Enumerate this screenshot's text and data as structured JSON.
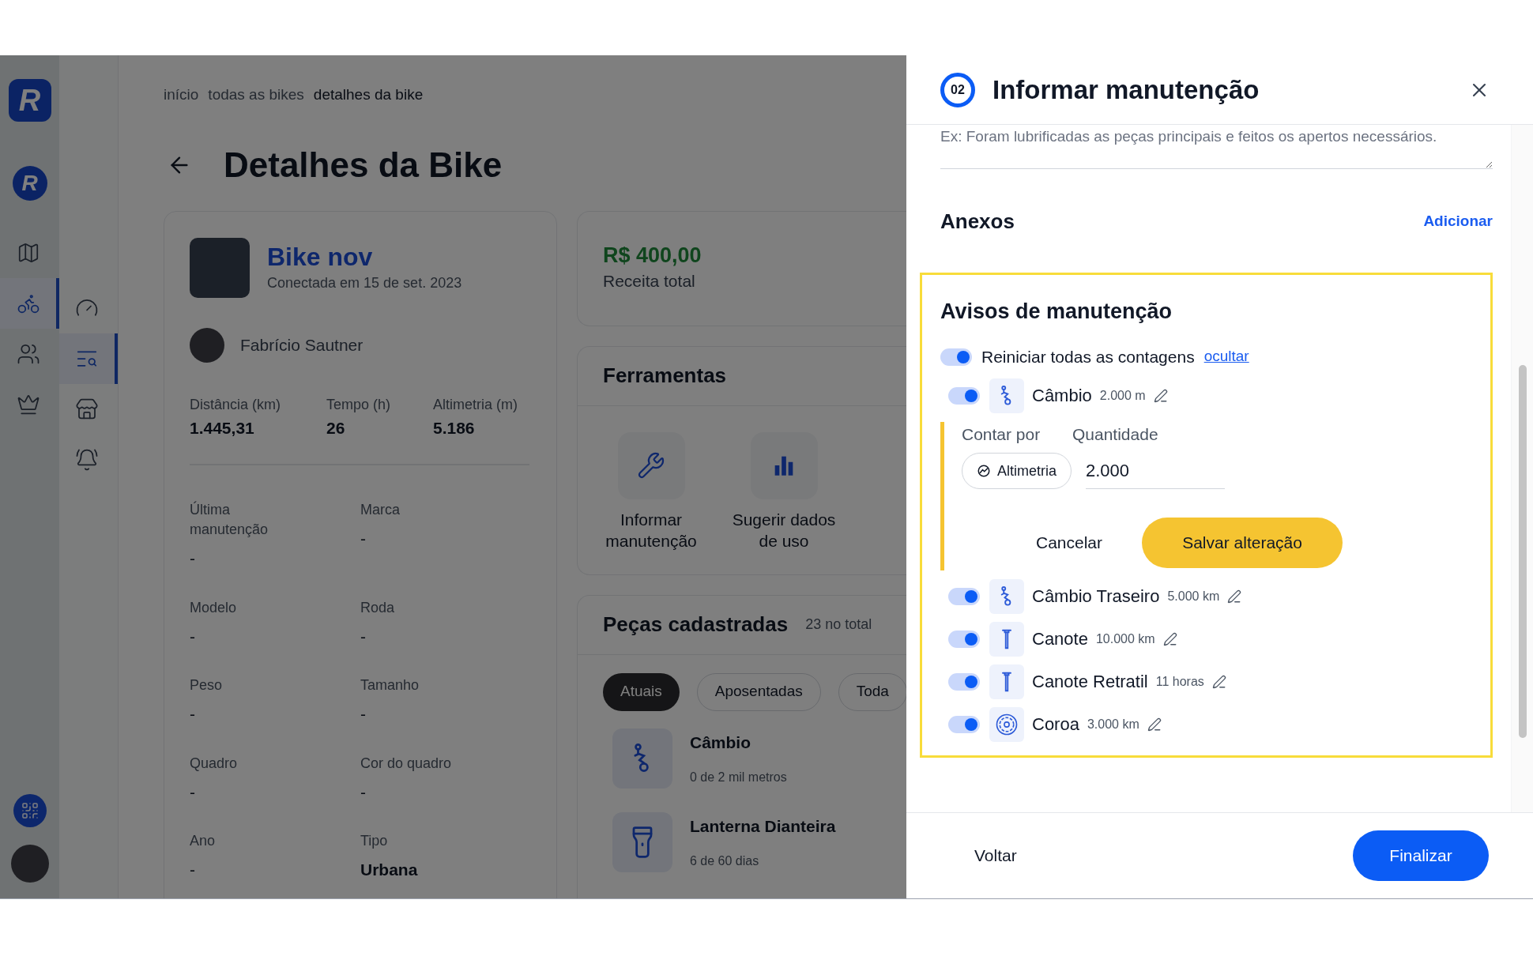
{
  "sidebar": {
    "logo": "R",
    "brand": "R",
    "primary": [
      {
        "kind": "map",
        "selected": false
      },
      {
        "kind": "bike",
        "selected": true
      },
      {
        "kind": "users",
        "selected": false
      },
      {
        "kind": "crown",
        "selected": false
      }
    ],
    "secondary": [
      {
        "kind": "gauge",
        "selected": false
      },
      {
        "kind": "search-list",
        "selected": true
      },
      {
        "kind": "store",
        "selected": false
      },
      {
        "kind": "bell",
        "selected": false
      }
    ]
  },
  "breadcrumb": [
    {
      "label": "início",
      "current": false
    },
    {
      "label": "todas as bikes",
      "current": false
    },
    {
      "label": "detalhes da bike",
      "current": true
    }
  ],
  "page_title": "Detalhes da Bike",
  "bike": {
    "name": "Bike nov",
    "connected": "Conectada em 15 de set. 2023",
    "owner": "Fabrício Sautner",
    "stats": [
      {
        "label": "Distância (km)",
        "value": "1.445,31"
      },
      {
        "label": "Tempo (h)",
        "value": "26"
      },
      {
        "label": "Altimetria (m)",
        "value": "5.186"
      }
    ],
    "specs": [
      {
        "label": "Última manutenção",
        "value": "-"
      },
      {
        "label": "Marca",
        "value": "-"
      },
      {
        "label": "Modelo",
        "value": "-"
      },
      {
        "label": "Roda",
        "value": "-"
      },
      {
        "label": "Peso",
        "value": "-"
      },
      {
        "label": "Tamanho",
        "value": "-"
      },
      {
        "label": "Quadro",
        "value": "-"
      },
      {
        "label": "Cor do quadro",
        "value": "-"
      },
      {
        "label": "Ano",
        "value": "-"
      },
      {
        "label": "Tipo",
        "value": "Urbana"
      }
    ]
  },
  "revenue": {
    "value": "R$ 400,00",
    "label": "Receita total"
  },
  "tools": {
    "title": "Ferramentas",
    "items": [
      {
        "kind": "wrench",
        "label": "Informar manutenção"
      },
      {
        "kind": "bars",
        "label": "Sugerir dados de uso"
      }
    ]
  },
  "parts": {
    "title": "Peças cadastradas",
    "count": "23 no total",
    "filters": [
      {
        "label": "Atuais",
        "selected": true
      },
      {
        "label": "Aposentadas",
        "selected": false
      },
      {
        "label": "Toda",
        "selected": false
      }
    ],
    "items": [
      {
        "kind": "derailleur",
        "name": "Câmbio",
        "usage": "0 de 2 mil metros"
      },
      {
        "kind": "light",
        "name": "Lanterna Dianteira",
        "usage": "6 de 60 dias"
      }
    ]
  },
  "drawer": {
    "step": "02",
    "title": "Informar manutenção",
    "notes": {
      "placeholder": "Ex: Foram lubrificadas as peças principais e feitos os apertos necessários."
    },
    "attachments": {
      "title": "Anexos",
      "action": "Adicionar"
    },
    "warnings": {
      "title": "Avisos de manutenção",
      "reset": {
        "label": "Reiniciar todas as contagens",
        "on": true,
        "link": "ocultar"
      },
      "items": [
        {
          "kind": "derailleur",
          "name": "Câmbio",
          "amount": "2.000 m",
          "on": true,
          "editor": {
            "count_by_label": "Contar por",
            "count_by": "Altimetria",
            "quantity_label": "Quantidade",
            "quantity": "2.000",
            "cancel": "Cancelar",
            "save": "Salvar alteração"
          }
        },
        {
          "kind": "derailleur",
          "name": "Câmbio Traseiro",
          "amount": "5.000 km",
          "on": true
        },
        {
          "kind": "seatpost",
          "name": "Canote",
          "amount": "10.000 km",
          "on": true
        },
        {
          "kind": "seatpost",
          "name": "Canote Retratil",
          "amount": "11 horas",
          "on": true
        },
        {
          "kind": "chainring",
          "name": "Coroa",
          "amount": "3.000 km",
          "on": true
        }
      ]
    },
    "footer": {
      "back": "Voltar",
      "finish": "Finalizar"
    }
  }
}
